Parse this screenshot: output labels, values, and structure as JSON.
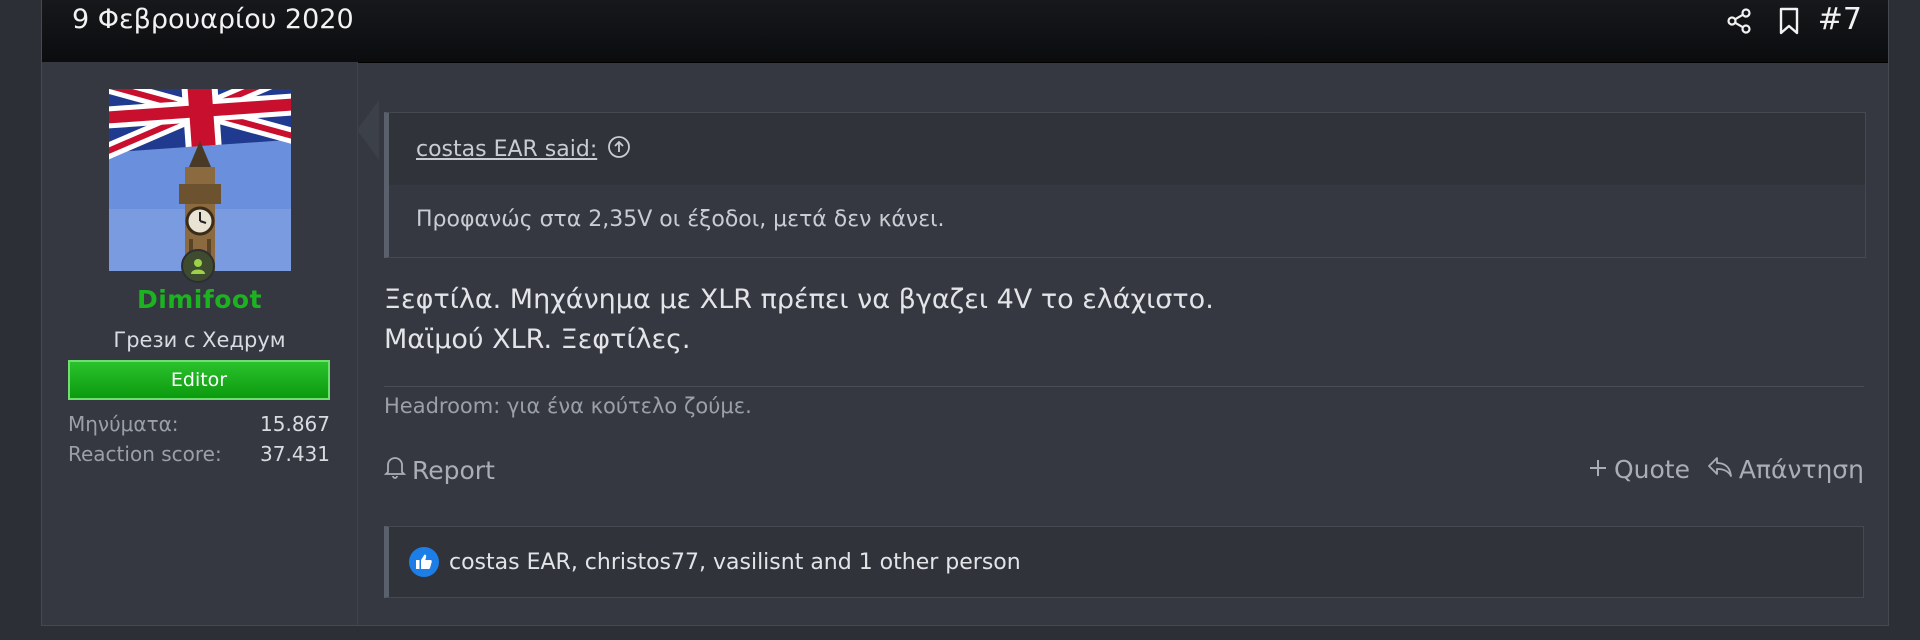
{
  "header": {
    "date": "9 Φεβρουαρίου 2020",
    "post_number": "#7",
    "share_icon": "share-icon",
    "bookmark_icon": "bookmark-icon"
  },
  "user": {
    "name": "Dimifoot",
    "title": "Грези с Хедрум",
    "banner": "Editor",
    "stats": [
      {
        "label": "Μηνύματα:",
        "value": "15.867"
      },
      {
        "label": "Reaction score:",
        "value": "37.431"
      }
    ],
    "name_color": "#1bb320",
    "online": true
  },
  "quote": {
    "author": "costas EAR said:",
    "text": "Προφανώς στα 2,35V οι έξοδοι, μετά δεν κάνει."
  },
  "message": {
    "lines": [
      "Ξεφτίλα. Μηχάνημα με XLR πρέπει να βγαζει 4V το ελάχιστο.",
      "Μαϊμού XLR. Ξεφτίλες."
    ]
  },
  "signature": "Headroom: για ένα κούτελο ζούμε.",
  "actions": {
    "report": "Report",
    "quote": "Quote",
    "reply": "Απάντηση"
  },
  "reactions": {
    "text": "costas EAR, christos77, vasilisnt and 1 other person",
    "icon": "like-icon",
    "color": "#1d7ee8"
  }
}
